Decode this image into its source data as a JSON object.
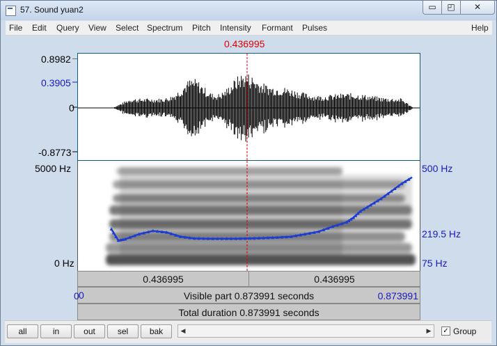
{
  "window": {
    "title": "57. Sound yuan2",
    "min_glyph": "▭",
    "max_glyph": "◰",
    "close_glyph": "✕"
  },
  "menu": [
    "File",
    "Edit",
    "Query",
    "View",
    "Select",
    "Spectrum",
    "Pitch",
    "Intensity",
    "Formant",
    "Pulses"
  ],
  "help_label": "Help",
  "cursor": {
    "time_label": "0.436995"
  },
  "waveform": {
    "ymax": "0.8982",
    "yhigh": "0.3905",
    "yzero": "0",
    "ymin": "-0.8773"
  },
  "spectrogram": {
    "fmax": "5000 Hz",
    "fmin": "0 Hz",
    "pitch_max": "500 Hz",
    "pitch_cursor": "219.5 Hz",
    "pitch_min": "75 Hz"
  },
  "time_bars": {
    "left_half": "0.436995",
    "right_half": "0.436995",
    "visible_start": "0",
    "visible_label": "Visible part 0.873991 seconds",
    "visible_end": "0.873991",
    "total_label": "Total duration 0.873991 seconds"
  },
  "buttons": [
    "all",
    "in",
    "out",
    "sel",
    "bak"
  ],
  "scroll": {
    "left_arrow": "◀",
    "right_arrow": "▶"
  },
  "group": {
    "label": "Group",
    "checked": "✓"
  },
  "colors": {
    "cursor": "#e00000",
    "axis_blue": "#1a1ac0",
    "pitch_line": "#1e3cd0"
  },
  "pitch_contour": {
    "x_seconds": [
      0.0,
      0.02,
      0.04,
      0.08,
      0.12,
      0.16,
      0.2,
      0.24,
      0.28,
      0.32,
      0.36,
      0.4,
      0.44,
      0.48,
      0.52,
      0.56,
      0.6,
      0.64,
      0.68,
      0.7,
      0.72,
      0.75,
      0.78,
      0.81,
      0.84,
      0.87
    ],
    "y_hz": [
      235,
      190,
      195,
      215,
      228,
      222,
      205,
      198,
      197,
      197,
      197,
      198,
      200,
      202,
      205,
      215,
      225,
      245,
      262,
      280,
      305,
      330,
      355,
      385,
      415,
      440
    ]
  }
}
